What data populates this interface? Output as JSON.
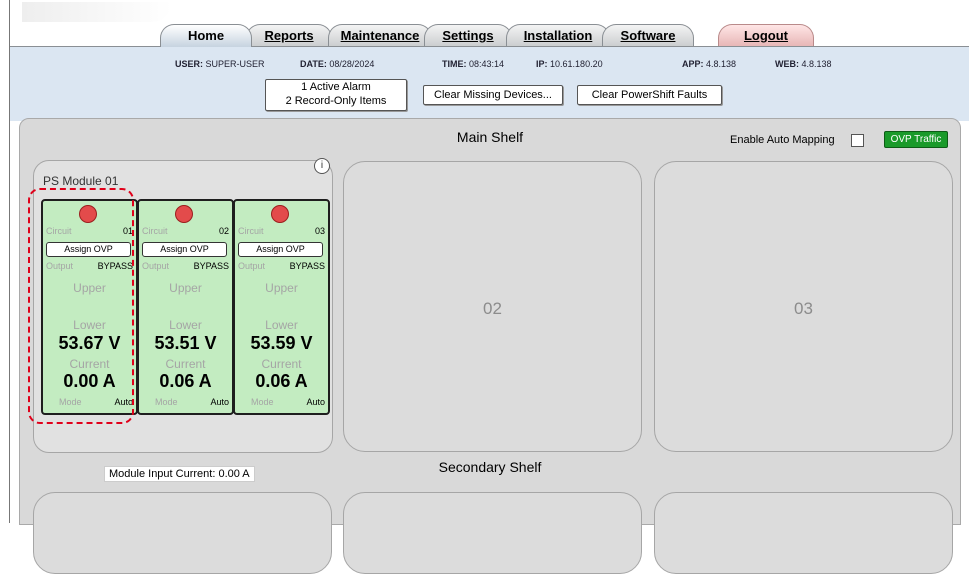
{
  "nav": {
    "tabs": [
      {
        "label": "Home",
        "active": true
      },
      {
        "label": "Reports"
      },
      {
        "label": "Maintenance"
      },
      {
        "label": "Settings"
      },
      {
        "label": "Installation"
      },
      {
        "label": "Software"
      }
    ],
    "logout": "Logout"
  },
  "info": {
    "user_label": "USER:",
    "user": "SUPER-USER",
    "date_label": "DATE:",
    "date": "08/28/2024",
    "time_label": "TIME:",
    "time": "08:43:14",
    "ip_label": "IP:",
    "ip": "10.61.180.20",
    "app_label": "APP:",
    "app": "4.8.138",
    "web_label": "WEB:",
    "web": "4.8.138"
  },
  "alarms": {
    "line1": "1 Active Alarm",
    "line2": "2 Record-Only Items"
  },
  "buttons": {
    "clear_missing": "Clear Missing Devices...",
    "clear_powershift": "Clear PowerShift Faults"
  },
  "main_shelf": {
    "title": "Main Shelf",
    "auto_mapping": "Enable Auto Mapping",
    "ovp_traffic": "OVP Traffic",
    "colors": {
      "ovp_traffic": "#1a9a2a",
      "circuit_bg": "#c3ecc1",
      "led": "#e34b4b",
      "highlight": "#e0001a"
    },
    "module": {
      "title": "PS Module 01",
      "info_icon": "i",
      "input_current": "Module Input Current: 0.00 A",
      "circuits": [
        {
          "circuit_label": "Circuit",
          "circuit": "01",
          "assign": "Assign OVP",
          "output_label": "Output",
          "output": "BYPASS",
          "upper": "Upper",
          "lower": "Lower",
          "voltage": "53.67 V",
          "current_label": "Current",
          "current": "0.00 A",
          "mode_label": "Mode",
          "mode": "Auto"
        },
        {
          "circuit_label": "Circuit",
          "circuit": "02",
          "assign": "Assign OVP",
          "output_label": "Output",
          "output": "BYPASS",
          "upper": "Upper",
          "lower": "Lower",
          "voltage": "53.51 V",
          "current_label": "Current",
          "current": "0.06 A",
          "mode_label": "Mode",
          "mode": "Auto"
        },
        {
          "circuit_label": "Circuit",
          "circuit": "03",
          "assign": "Assign OVP",
          "output_label": "Output",
          "output": "BYPASS",
          "upper": "Upper",
          "lower": "Lower",
          "voltage": "53.59 V",
          "current_label": "Current",
          "current": "0.06 A",
          "mode_label": "Mode",
          "mode": "Auto"
        }
      ]
    },
    "bays": [
      "02",
      "03"
    ]
  },
  "secondary_shelf": {
    "title": "Secondary Shelf"
  }
}
